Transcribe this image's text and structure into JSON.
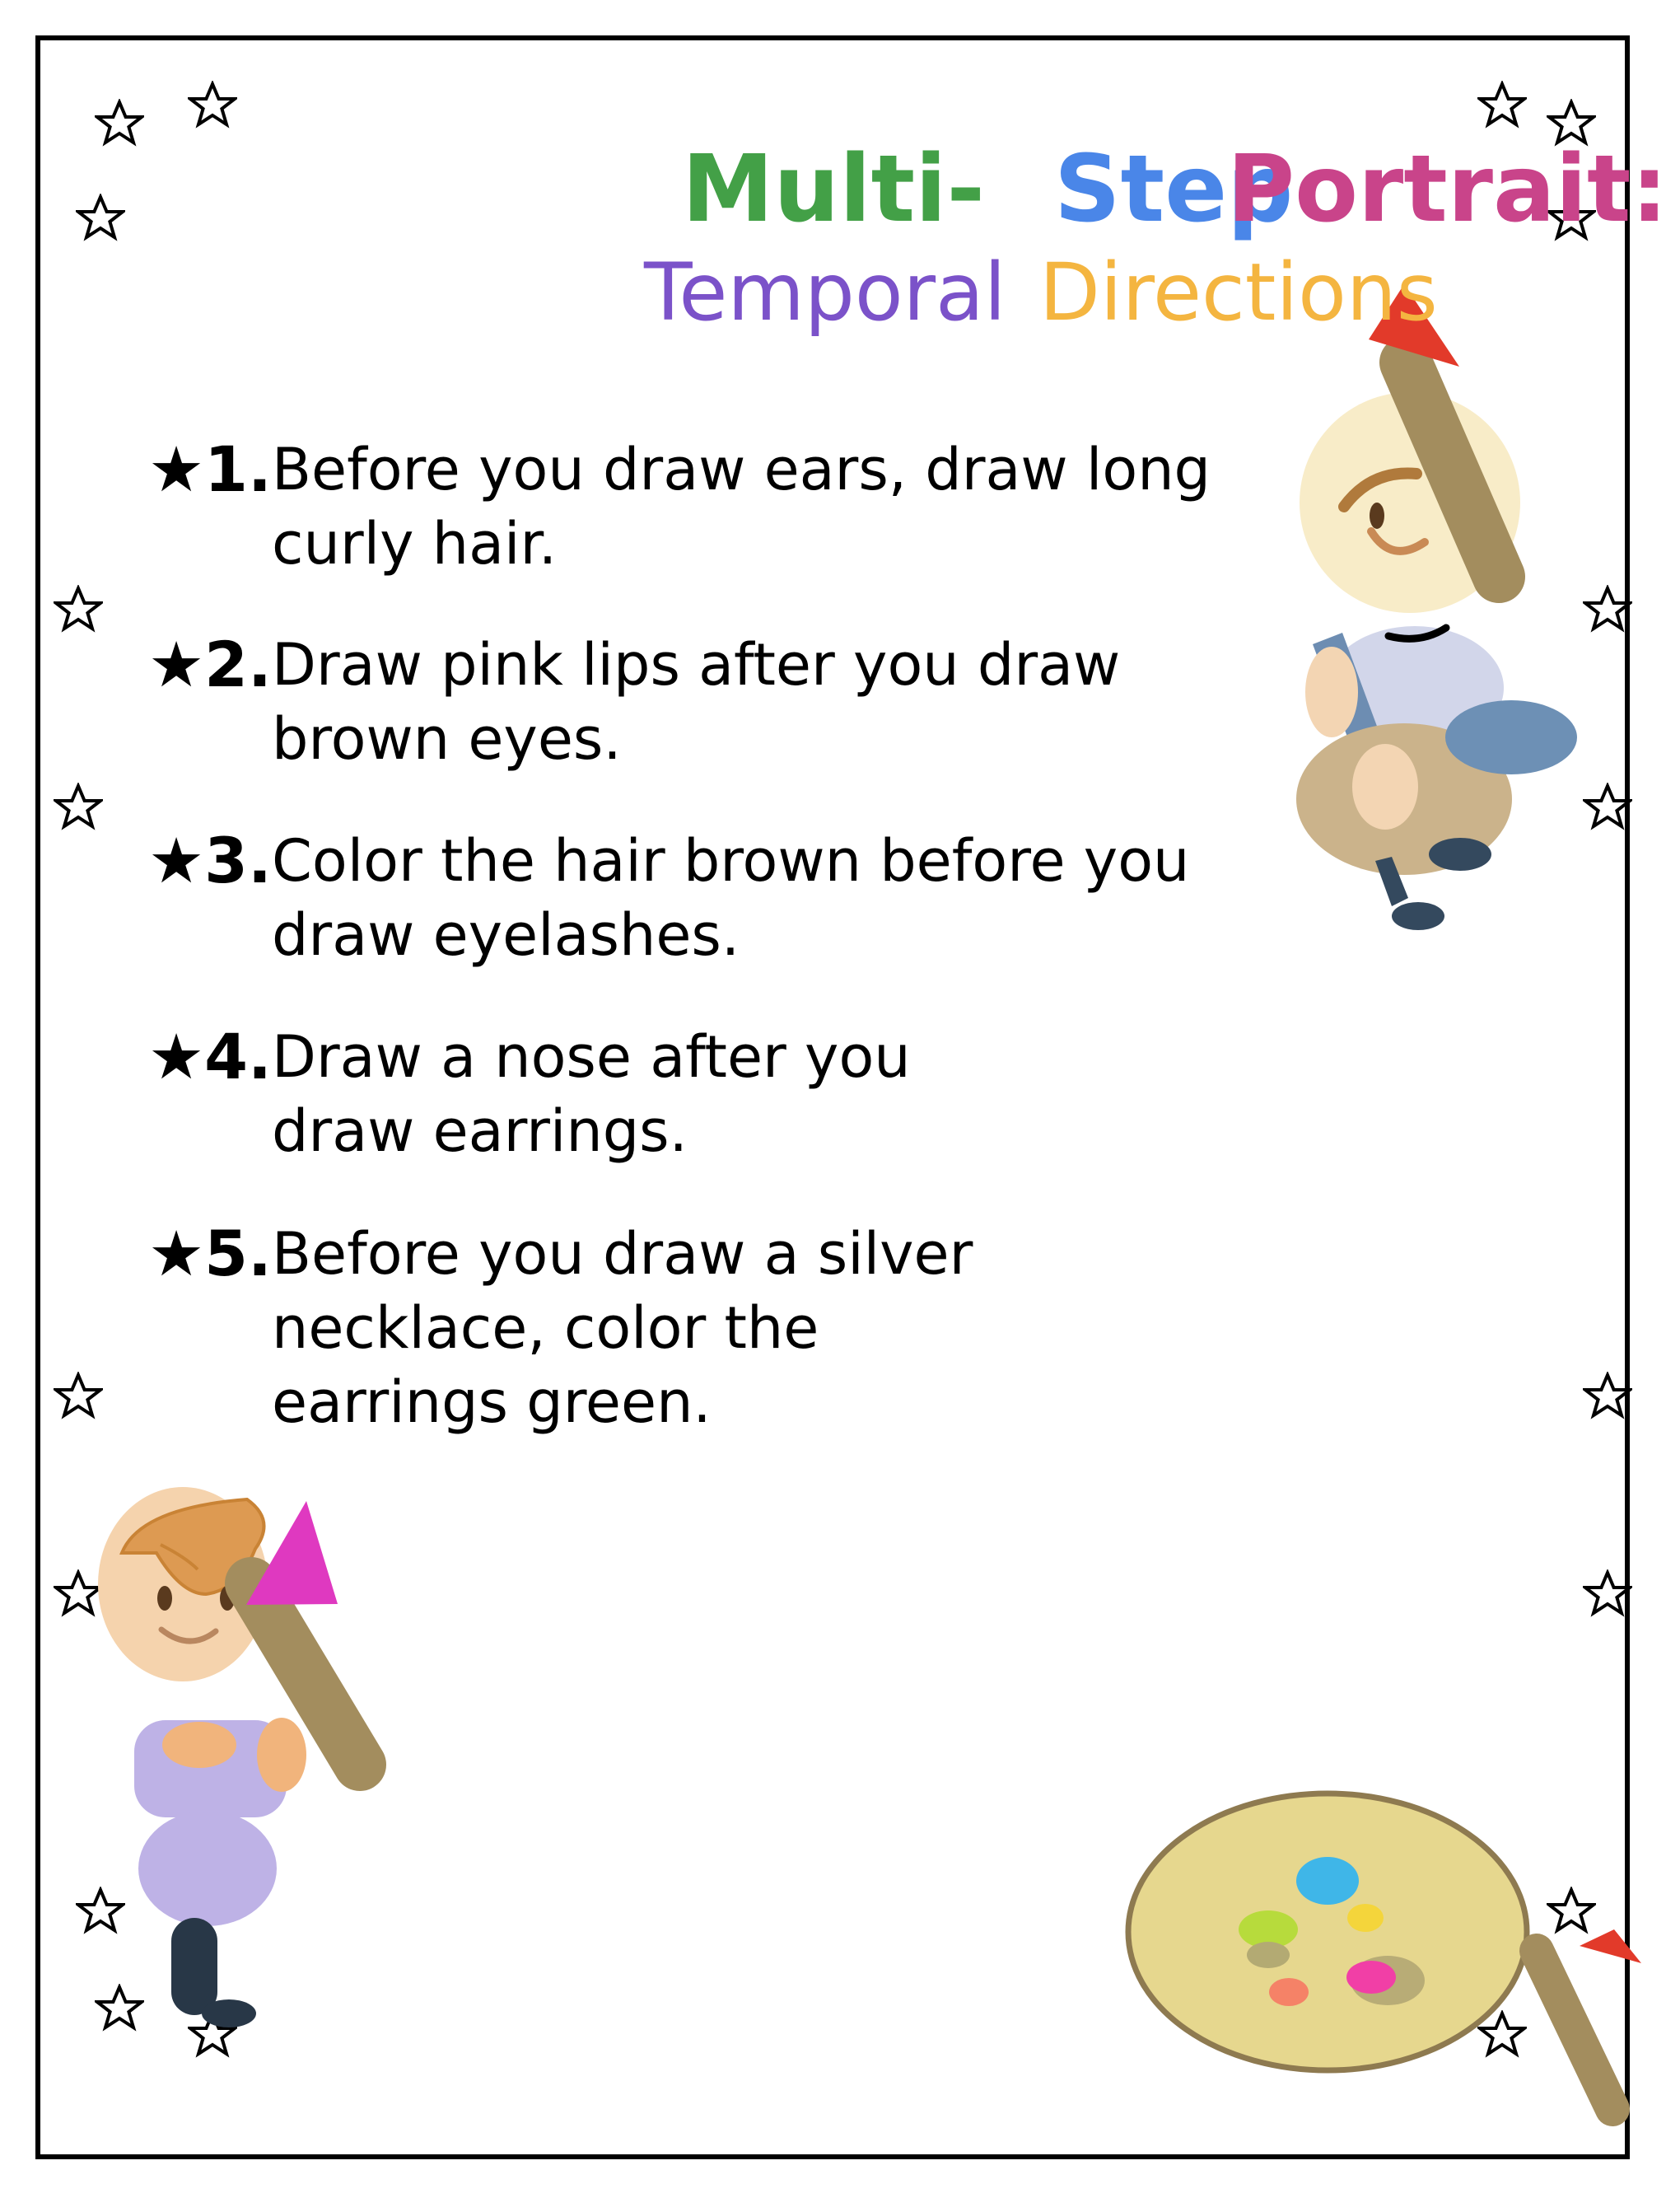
{
  "title": {
    "word1": "Multi-",
    "word2": "Step",
    "word3": "Portrait:",
    "word4": "Temporal",
    "word5": "Directions"
  },
  "colors": {
    "word1": "#43a047",
    "word2": "#4a86e8",
    "word3": "#c9448a",
    "word4": "#7b52c9",
    "word5": "#f4b540"
  },
  "bullet_icon": "star-icon",
  "instructions": [
    {
      "marker": "★1.",
      "text": "Before you draw ears, draw long curly hair."
    },
    {
      "marker": "★2.",
      "text": "Draw pink lips after you draw brown eyes."
    },
    {
      "marker": "★3.",
      "text": "Color the hair brown before you draw eyelashes."
    },
    {
      "marker": "★4.",
      "text": "Draw a nose after you draw earrings."
    },
    {
      "marker": "★5.",
      "text": "Before you draw a silver necklace, color the earrings green."
    }
  ],
  "decorations": [
    "star-icon",
    "child-with-pencil-icon",
    "pencil-icon",
    "paint-palette-icon"
  ]
}
